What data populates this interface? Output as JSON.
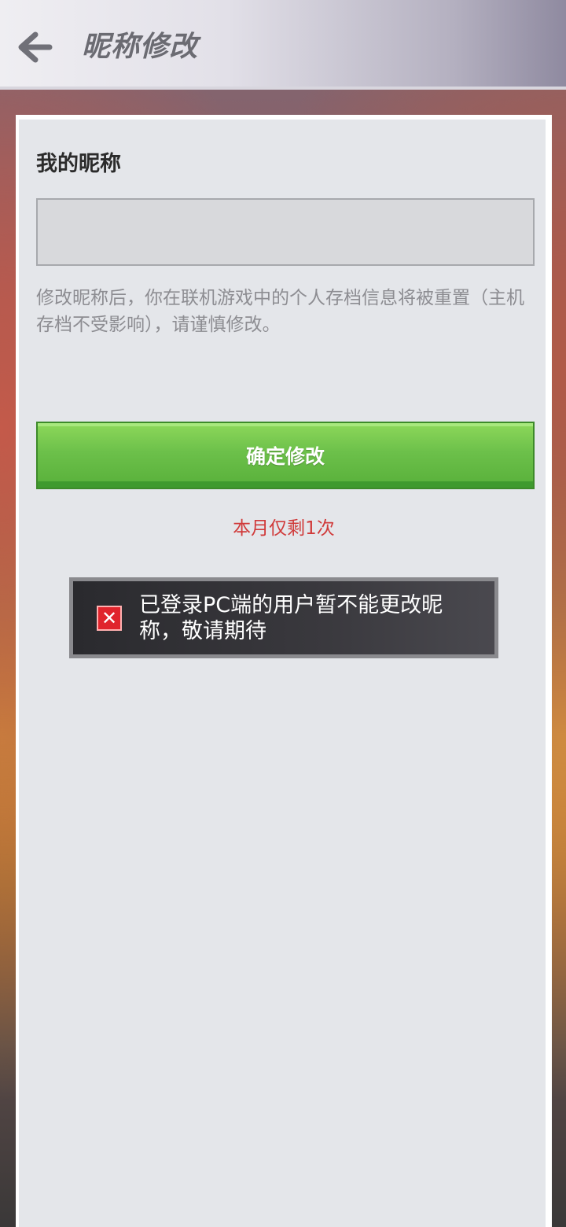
{
  "header": {
    "back_icon": "arrow-left-icon",
    "title": "昵称修改"
  },
  "form": {
    "label": "我的昵称",
    "nickname_value": "",
    "notice": "修改昵称后，你在联机游戏中的个人存档信息将被重置（主机存档不受影响），请谨慎修改。",
    "confirm_label": "确定修改",
    "remaining_text": "本月仅剩1次"
  },
  "toast": {
    "icon": "error-icon",
    "icon_glyph": "✕",
    "message": "已登录PC端的用户暂不能更改昵称，敬请期待"
  },
  "colors": {
    "confirm_green": "#6cc04a",
    "remaining_red": "#d03a3a",
    "error_red": "#e0242c"
  }
}
